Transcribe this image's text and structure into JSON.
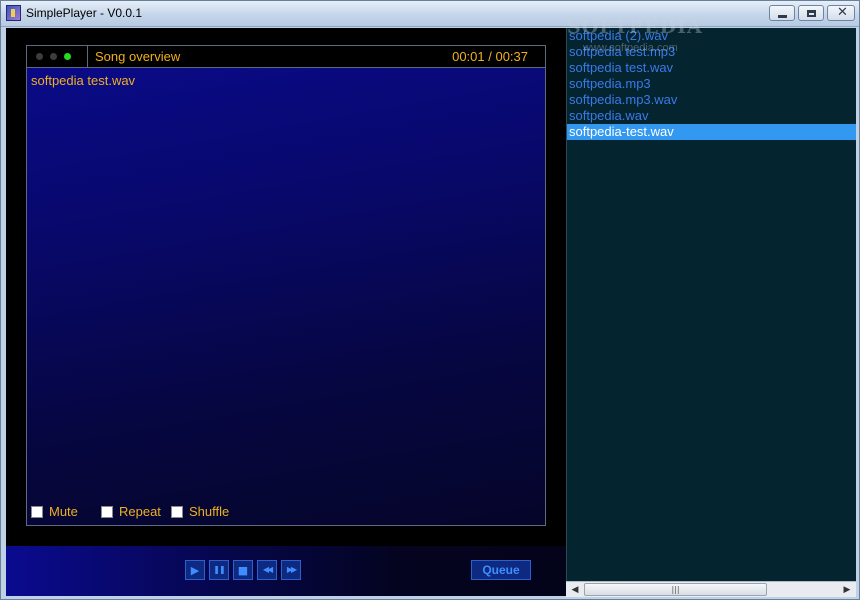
{
  "window": {
    "title": "SimplePlayer - V0.0.1",
    "minimize_glyph": "",
    "maximize_glyph": "",
    "close_glyph": "✕"
  },
  "viz": {
    "header_title": "Song overview",
    "time": "00:01 / 00:37",
    "current_file": "softpedia test.wav",
    "indicator_colors": [
      "#3d3d3d",
      "#3d3d3d",
      "#22dd22"
    ],
    "accent_color": "#f0b020"
  },
  "options": {
    "mute_label": "Mute",
    "repeat_label": "Repeat",
    "shuffle_label": "Shuffle"
  },
  "controls": {
    "play_icon": "▶",
    "pause_icon": "❚❚",
    "stop_icon": "■",
    "prev_icon": "◀◀",
    "next_icon": "▶▶",
    "queue_label": "Queue"
  },
  "playlist": {
    "watermark": "SOFTPEDIA",
    "watermark_sub": "www.softpedia.com",
    "items": [
      "softpedia (2).wav",
      "softpedia test.mp3",
      "softpedia test.wav",
      "softpedia.mp3",
      "softpedia.mp3.wav",
      "softpedia.wav",
      "softpedia-test.wav"
    ],
    "selected_index": 6,
    "selected_color": "#3298f0"
  },
  "scrollbar": {
    "left_arrow": "◀",
    "right_arrow": "▶",
    "thumb_grip": "|||"
  }
}
